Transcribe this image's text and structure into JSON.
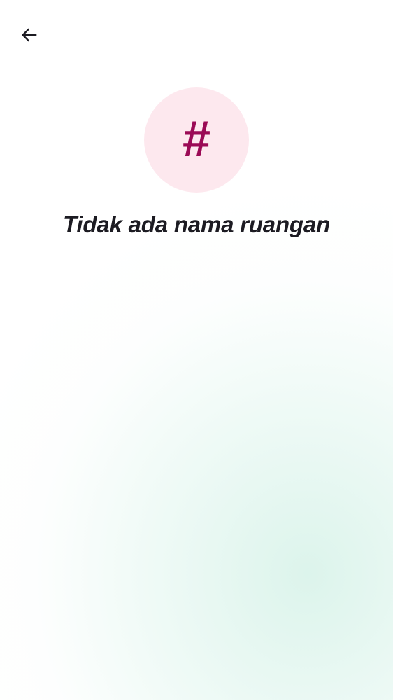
{
  "header": {
    "back_icon": "arrow-left-icon"
  },
  "room": {
    "avatar_glyph": "#",
    "avatar_bg_color": "#fde8ee",
    "avatar_fg_color": "#9b0a55",
    "name": "Tidak ada nama ruangan"
  },
  "colors": {
    "text": "#1c1b22",
    "background": "#ffffff",
    "gradient_tint": "#d6f2e8"
  }
}
